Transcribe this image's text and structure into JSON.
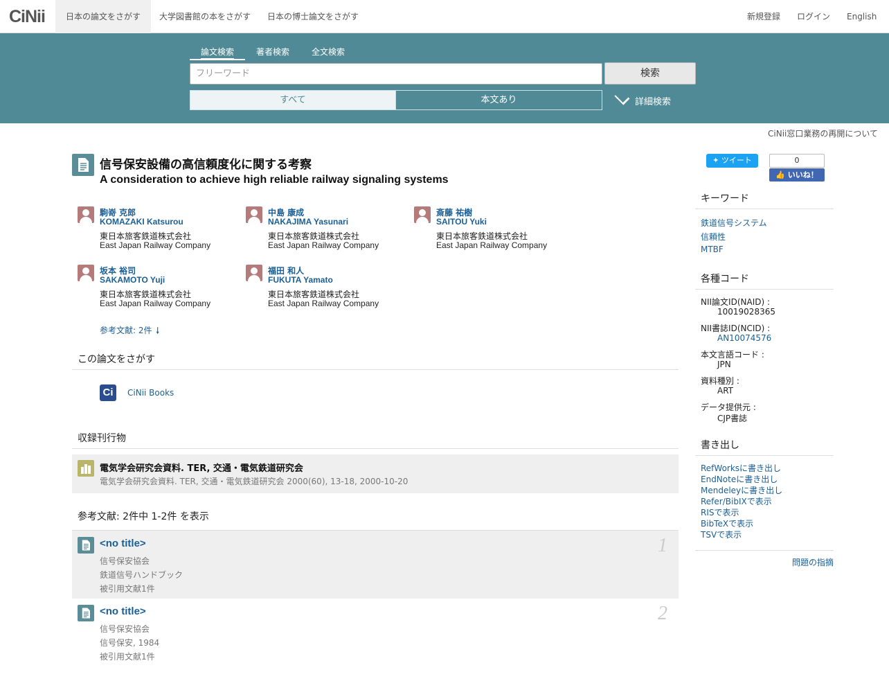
{
  "nav": {
    "logo": "CiNii",
    "tabs": [
      "日本の論文をさがす",
      "大学図書館の本をさがす",
      "日本の博士論文をさがす"
    ],
    "register": "新規登録",
    "login": "ログイン",
    "english": "English"
  },
  "search": {
    "tabs": [
      "論文検索",
      "著者検索",
      "全文検索"
    ],
    "placeholder": "フリーワード",
    "button": "検索",
    "filter_all": "すべて",
    "filter_fulltext": "本文あり",
    "advanced": "詳細検索"
  },
  "notice": "CiNii窓口業務の再開について",
  "paper": {
    "title_ja": "信号保安設備の高信頼度化に関する考察",
    "title_en": "A consideration to achieve high reliable railway signaling systems",
    "authors": [
      {
        "name_ja": "駒嵜 克郎",
        "name_en": "KOMAZAKI Katsurou",
        "aff_ja": "東日本旅客鉄道株式会社",
        "aff_en": "East Japan Railway Company"
      },
      {
        "name_ja": "中島 康成",
        "name_en": "NAKAJIMA Yasunari",
        "aff_ja": "東日本旅客鉄道株式会社",
        "aff_en": "East Japan Railway Company"
      },
      {
        "name_ja": "斎藤 祐樹",
        "name_en": "SAITOU Yuki",
        "aff_ja": "東日本旅客鉄道株式会社",
        "aff_en": "East Japan Railway Company"
      },
      {
        "name_ja": "坂本 裕司",
        "name_en": "SAKAMOTO Yuji",
        "aff_ja": "東日本旅客鉄道株式会社",
        "aff_en": "East Japan Railway Company"
      },
      {
        "name_ja": "福田 和人",
        "name_en": "FUKUTA Yamato",
        "aff_ja": "東日本旅客鉄道株式会社",
        "aff_en": "East Japan Railway Company"
      }
    ],
    "ref_link": "参考文献: 2件"
  },
  "find": {
    "heading": "この論文をさがす",
    "cinii_books": "CiNii Books",
    "icon_letter": "Ci"
  },
  "journal": {
    "heading": "収録刊行物",
    "title": "電気学会研究会資料. TER, 交通・電気鉄道研究会",
    "detail": "電気学会研究会資料. TER, 交通・電気鉄道研究会 2000(60), 13-18, 2000-10-20"
  },
  "references": {
    "heading": "参考文献:  2件中 1-2件 を表示",
    "items": [
      {
        "title": "<no title>",
        "publisher": "信号保安協会",
        "source": "鉄道信号ハンドブック",
        "cited": "被引用文献1件",
        "num": "1"
      },
      {
        "title": "<no title>",
        "publisher": "信号保安協会",
        "source": "信号保安, 1984",
        "cited": "被引用文献1件",
        "num": "2"
      }
    ]
  },
  "sidebar": {
    "tweet": "ツイート",
    "like_count": "0",
    "like": "いいね！",
    "keywords_heading": "キーワード",
    "keywords": [
      "鉄道信号システム",
      "信頼性",
      "MTBF"
    ],
    "codes_heading": "各種コード",
    "codes": [
      {
        "key": "NII論文ID(NAID) :",
        "value": "10019028365"
      },
      {
        "key": "NII書誌ID(NCID) :",
        "value": "AN10074576"
      },
      {
        "key": "本文言語コード :",
        "value": "JPN"
      },
      {
        "key": "資料種別 :",
        "value": "ART"
      },
      {
        "key": "データ提供元 :",
        "value": "CJP書誌"
      }
    ],
    "export_heading": "書き出し",
    "exports": [
      "RefWorksに書き出し",
      "EndNoteに書き出し",
      "Mendeleyに書き出し",
      "Refer/BibIXで表示",
      "RISで表示",
      "BibTeXで表示",
      "TSVで表示"
    ],
    "report": "問題の指摘"
  },
  "colors": {
    "band": "#4f8a96",
    "link": "#1a5f96",
    "avatar": "#b57a7a",
    "journal_icon": "#b9b56a"
  }
}
